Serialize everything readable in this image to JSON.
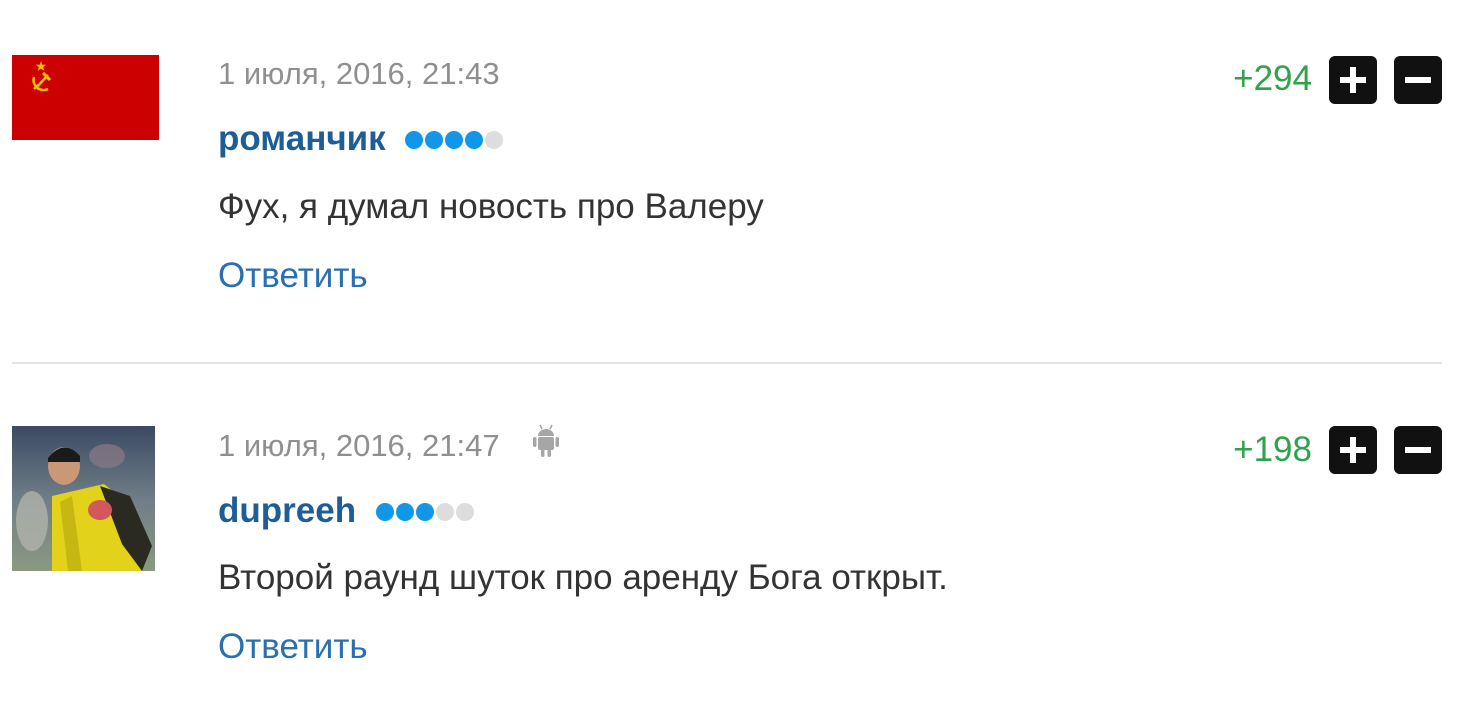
{
  "comments": [
    {
      "avatar": "ussr-flag-avatar",
      "date": "1 июля, 2016, 21:43",
      "device_icon": null,
      "author": "романчик",
      "rating": {
        "filled": 4,
        "total": 5
      },
      "text": "Фух, я думал новость про Валеру",
      "reply_label": "Ответить",
      "score": "+294"
    },
    {
      "avatar": "goalkeeper-photo-avatar",
      "date": "1 июля, 2016, 21:47",
      "device_icon": "android-icon",
      "author": "dupreeh",
      "rating": {
        "filled": 3,
        "total": 5
      },
      "text": "Второй раунд шуток про аренду Бога открыт.",
      "reply_label": "Ответить",
      "score": "+198"
    }
  ],
  "colors": {
    "author": "#1e5e97",
    "reply_link": "#2a6fb0",
    "score_positive": "#2fa24b",
    "rating_on": "#1196e8",
    "rating_off": "#dddddd",
    "vote_button": "#111111"
  }
}
